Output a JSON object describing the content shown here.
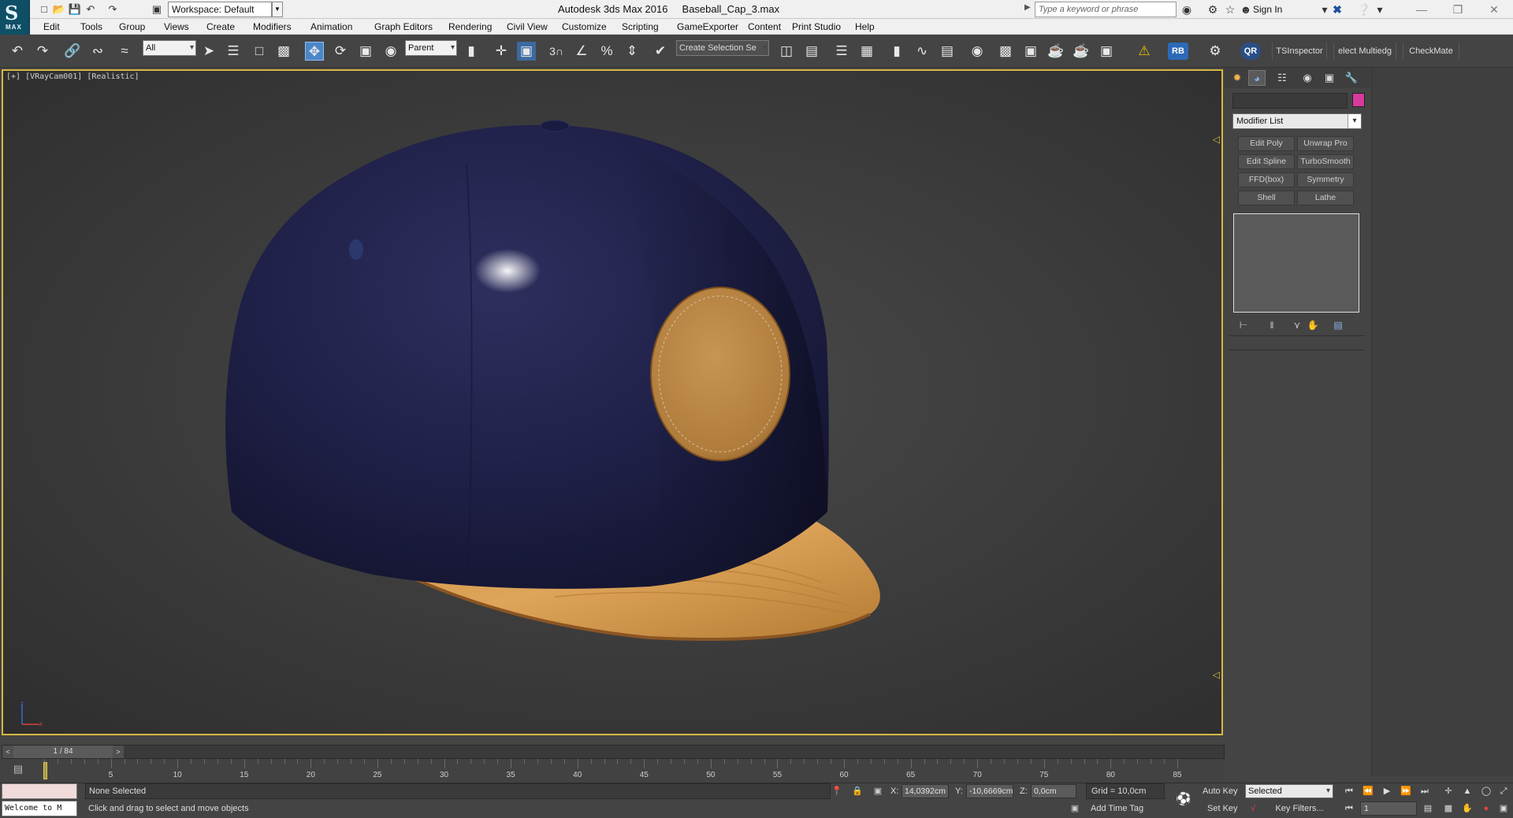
{
  "titlebar": {
    "app_logo": "MAX",
    "workspace": "Workspace: Default",
    "title": "Autodesk 3ds Max 2016     Baseball_Cap_3.max",
    "search_placeholder": "Type a keyword or phrase",
    "sign_in": "Sign In"
  },
  "menu": [
    "Edit",
    "Tools",
    "Group",
    "Views",
    "Create",
    "Modifiers",
    "Animation",
    "Graph Editors",
    "Rendering",
    "Civil View",
    "Customize",
    "Scripting",
    "GameExporter",
    "Content",
    "Print Studio",
    "Help"
  ],
  "toolbar": {
    "selection_filter": "All",
    "ref_coord": "Parent",
    "snap_3": "3",
    "named_selection": "Create Selection Se",
    "rb": "RB",
    "qr": "QR",
    "scripts": [
      "TSInspector",
      "elect Multiedg",
      "CheckMate"
    ]
  },
  "viewport": {
    "label": "[+] [VRayCam001] [Realistic]",
    "axis_x": "x",
    "axis_z": "z"
  },
  "command_panel": {
    "modifier_list": "Modifier List",
    "modifier_buttons": [
      "Edit Poly",
      "Unwrap Pro",
      "Edit Spline",
      "TurboSmooth",
      "FFD(box)",
      "Symmetry",
      "Shell",
      "Lathe"
    ],
    "object_color": "#d63a9b"
  },
  "timeline": {
    "frame_display": "1 / 84",
    "ticks": [
      5,
      10,
      15,
      20,
      25,
      30,
      35,
      40,
      45,
      50,
      55,
      60,
      65,
      70,
      75,
      80,
      85
    ]
  },
  "statusbar": {
    "welcome": "Welcome to M",
    "selection_status": "None Selected",
    "prompt": "Click and drag to select and move objects",
    "x_label": "X:",
    "x_value": "14,0392cm",
    "y_label": "Y:",
    "y_value": "-10,6669cm",
    "z_label": "Z:",
    "z_value": "0,0cm",
    "grid": "Grid = 10,0cm",
    "add_time_tag": "Add Time Tag",
    "auto_key": "Auto Key",
    "set_key": "Set Key",
    "key_mode": "Selected",
    "key_filters": "Key Filters...",
    "current_frame": "1"
  }
}
